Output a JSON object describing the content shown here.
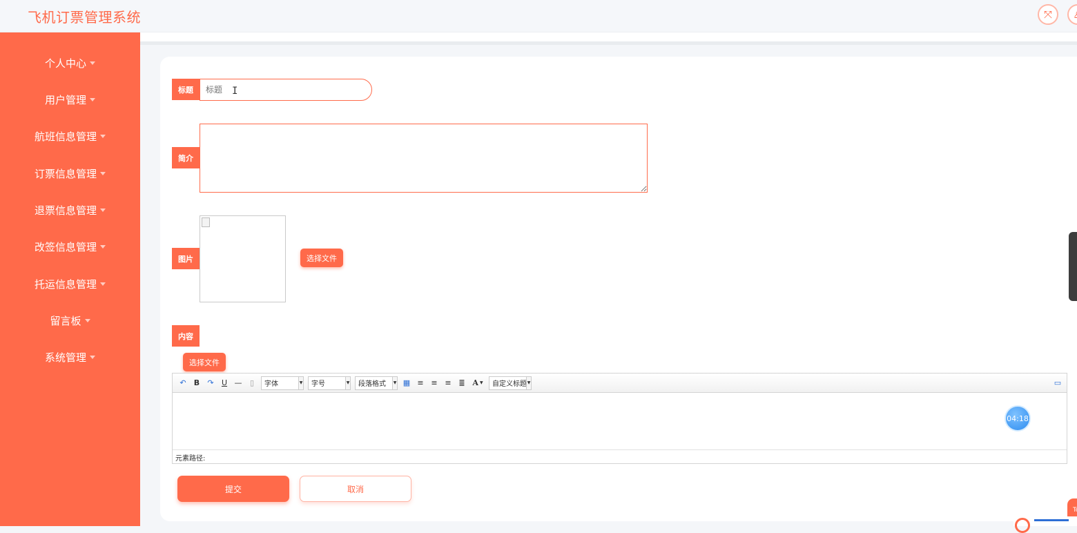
{
  "app": {
    "title": "飞机订票管理系统"
  },
  "topbar": {
    "icons": [
      "expand-icon",
      "user-icon"
    ]
  },
  "sidebar": {
    "items": [
      {
        "label": "个人中心"
      },
      {
        "label": "用户管理"
      },
      {
        "label": "航班信息管理"
      },
      {
        "label": "订票信息管理"
      },
      {
        "label": "退票信息管理"
      },
      {
        "label": "改签信息管理"
      },
      {
        "label": "托运信息管理"
      },
      {
        "label": "留言板"
      },
      {
        "label": "系统管理"
      }
    ]
  },
  "form": {
    "title_label": "标题",
    "title_placeholder": "标题",
    "title_value": "",
    "intro_label": "简介",
    "intro_value": "",
    "image_label": "图片",
    "image_upload": "选择文件",
    "content_label": "内容",
    "content_upload": "选择文件"
  },
  "editor": {
    "font_select": "字体",
    "size_select": "字号",
    "paragraph_select": "段落格式",
    "custom_title_select": "自定义标题",
    "bold": "B",
    "underline": "U",
    "font_color": "A",
    "status_path": "元素路径:"
  },
  "timer": {
    "value": "04:18"
  },
  "actions": {
    "submit": "提交",
    "cancel": "取消"
  },
  "floating": {
    "top_text": "To"
  },
  "colors": {
    "accent": "#ff6a4a",
    "timer_blue": "#2d8cf0"
  }
}
